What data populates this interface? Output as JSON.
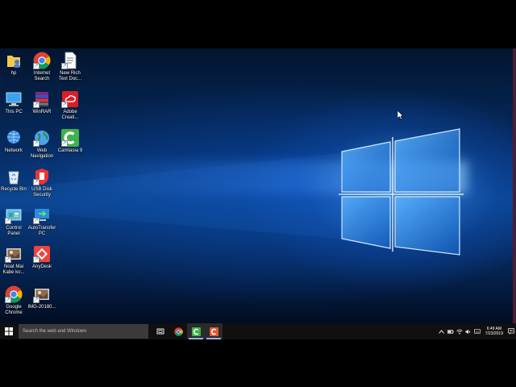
{
  "desktop": {
    "icons": [
      {
        "label": "hp",
        "icon": "user-folder-icon"
      },
      {
        "label": "Internet\nSearch",
        "icon": "chrome-icon"
      },
      {
        "label": "New Rich\nText Doc...",
        "icon": "document-icon"
      },
      {
        "label": "This PC",
        "icon": "computer-icon"
      },
      {
        "label": "WinRAR",
        "icon": "winrar-icon"
      },
      {
        "label": "Adobe\nCreati...",
        "icon": "adobe-creative-cloud-icon"
      },
      {
        "label": "Network",
        "icon": "network-icon"
      },
      {
        "label": "Web\nNavigation",
        "icon": "globe-icon"
      },
      {
        "label": "Camtasia 9",
        "icon": "camtasia-icon"
      },
      {
        "label": "Recycle Bin",
        "icon": "recycle-bin-icon"
      },
      {
        "label": "USB Disk\nSecurity",
        "icon": "usb-security-icon"
      },
      {
        "label": "Control\nPanel",
        "icon": "control-panel-icon"
      },
      {
        "label": "AutoTransfer\nPC",
        "icon": "autotransfer-icon"
      },
      {
        "label": "Noat Mai\nKabe ko...",
        "icon": "image-file-icon"
      },
      {
        "label": "AnyDesk",
        "icon": "anydesk-icon"
      },
      {
        "label": "Google\nChrome",
        "icon": "chrome-icon"
      },
      {
        "label": "IMG-20180...",
        "icon": "image-file-icon"
      }
    ]
  },
  "taskbar": {
    "search_placeholder": "Search the web and Windows",
    "pinned": [
      {
        "name": "task-view",
        "icon": "task-view-icon"
      },
      {
        "name": "chrome",
        "icon": "chrome-icon"
      },
      {
        "name": "camtasia",
        "icon": "camtasia-icon"
      },
      {
        "name": "camtasia-recorder",
        "icon": "camtasia-recorder-icon"
      }
    ],
    "clock_time": "6:49 AM",
    "clock_date": "7/23/2019"
  },
  "colors": {
    "taskbar": "#101010",
    "search_box": "#3a3a3a",
    "accent": "#8fb8ea"
  }
}
